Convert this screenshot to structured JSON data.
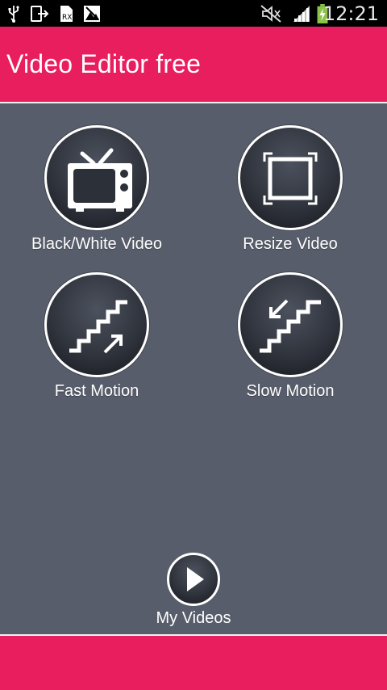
{
  "status_bar": {
    "time": "12:21",
    "icons": [
      "usb-icon",
      "download-icon",
      "sim-icon",
      "image-icon",
      "mute-icon",
      "signal-icon",
      "battery-charging-icon"
    ]
  },
  "app_bar": {
    "title": "Video Editor free"
  },
  "tiles": [
    {
      "label": "Black/White Video",
      "icon": "tv-icon"
    },
    {
      "label": "Resize Video",
      "icon": "resize-frame-icon"
    },
    {
      "label": "Fast Motion",
      "icon": "stairs-up-icon"
    },
    {
      "label": "Slow Motion",
      "icon": "stairs-down-icon"
    }
  ],
  "my_videos": {
    "label": "My Videos",
    "icon": "play-icon"
  },
  "colors": {
    "accent": "#e91e5f",
    "background": "#575d6a",
    "status_bar": "#000000"
  }
}
